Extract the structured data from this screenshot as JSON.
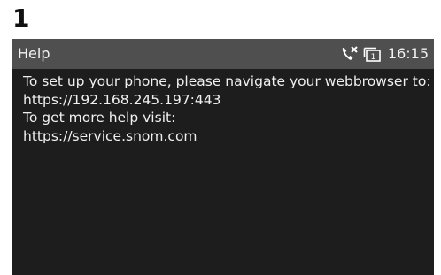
{
  "step": {
    "number": "1"
  },
  "statusbar": {
    "title": "Help",
    "time": "16:15",
    "icons": [
      "missed-call-icon",
      "line-key-1-icon"
    ],
    "line_badge": "1"
  },
  "help": {
    "line1": "To set up your phone, please navigate your webbrowser to:",
    "line2": "https://192.168.245.197:443",
    "line3": "To get more help visit:",
    "line4": "https://service.snom.com"
  },
  "colors": {
    "screen_bg": "#1d1d1d",
    "statusbar_bg": "#4f4f4f",
    "text": "#f0f0f0"
  }
}
